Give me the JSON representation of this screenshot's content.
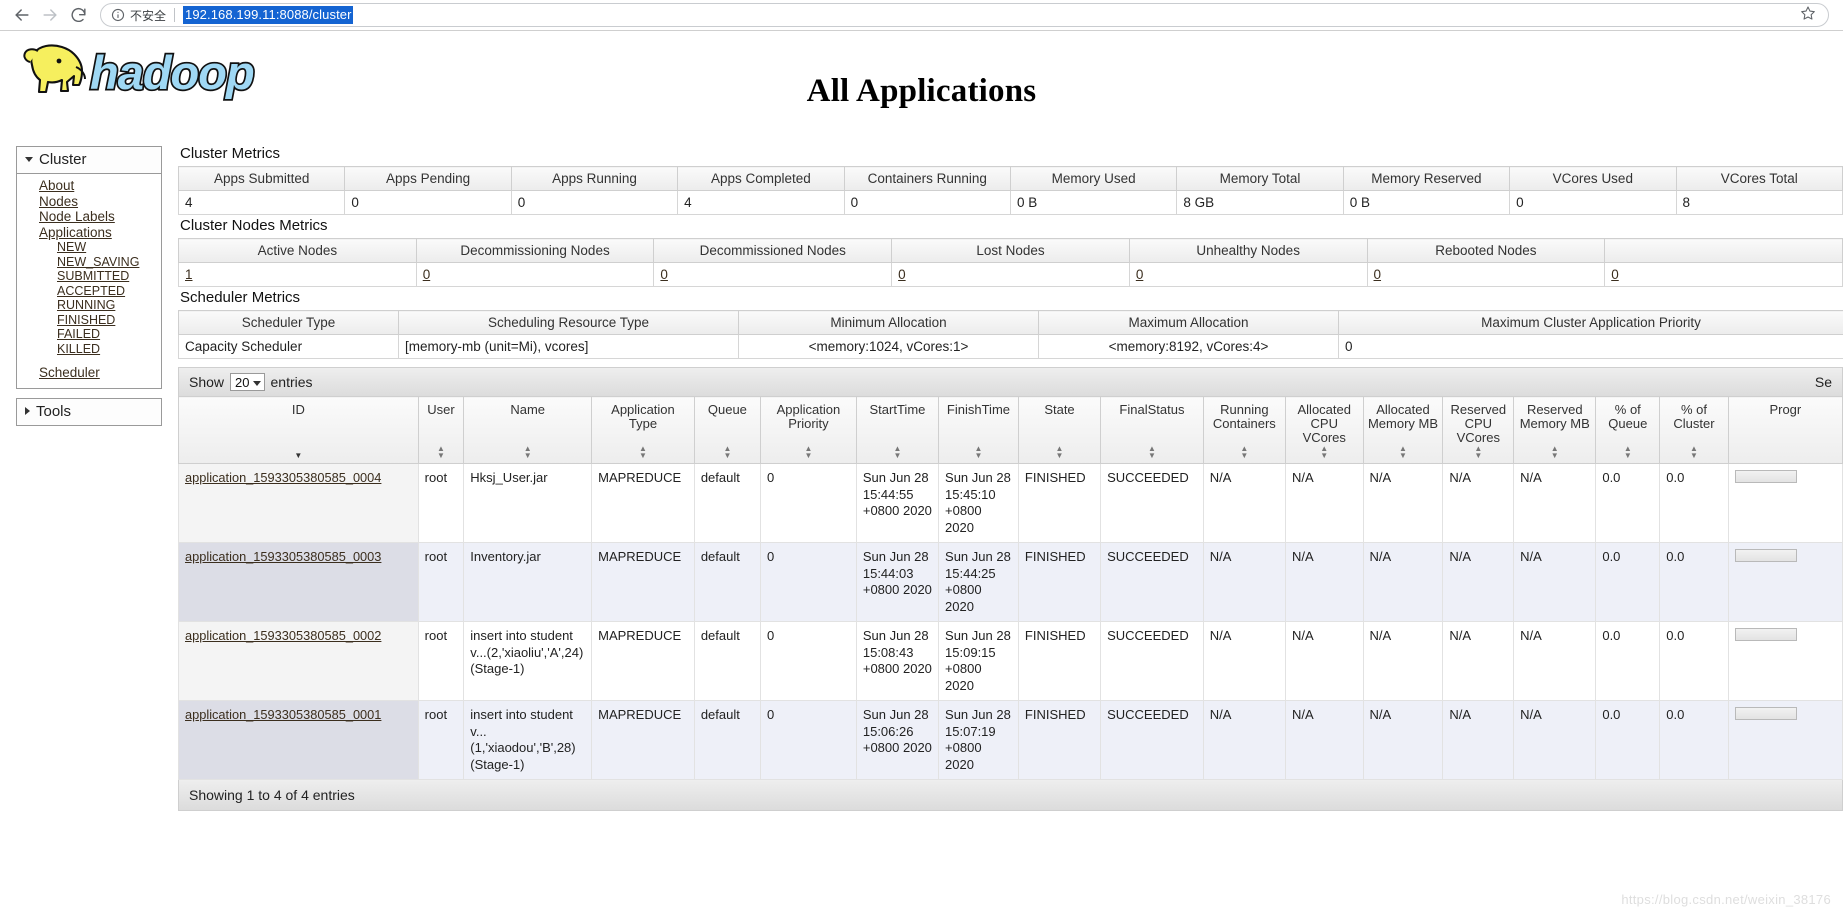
{
  "browser": {
    "back_icon": "back-arrow-icon",
    "forward_icon": "forward-arrow-icon",
    "reload_icon": "reload-icon",
    "info_icon": "info-circle-icon",
    "security_label": "不安全",
    "url": "192.168.199.11:8088/cluster",
    "star_icon": "bookmark-star-icon"
  },
  "header": {
    "logo_text": "hadoop",
    "title": "All Applications"
  },
  "sidebar": {
    "cluster": {
      "label": "Cluster",
      "items": [
        {
          "label": "About"
        },
        {
          "label": "Nodes"
        },
        {
          "label": "Node Labels"
        },
        {
          "label": "Applications"
        }
      ],
      "app_states": [
        {
          "label": "NEW"
        },
        {
          "label": "NEW_SAVING"
        },
        {
          "label": "SUBMITTED"
        },
        {
          "label": "ACCEPTED"
        },
        {
          "label": "RUNNING"
        },
        {
          "label": "FINISHED"
        },
        {
          "label": "FAILED"
        },
        {
          "label": "KILLED"
        }
      ],
      "scheduler": {
        "label": "Scheduler"
      }
    },
    "tools": {
      "label": "Tools"
    }
  },
  "cluster_metrics": {
    "title": "Cluster Metrics",
    "headers": [
      "Apps Submitted",
      "Apps Pending",
      "Apps Running",
      "Apps Completed",
      "Containers Running",
      "Memory Used",
      "Memory Total",
      "Memory Reserved",
      "VCores Used",
      "VCores Total"
    ],
    "values": [
      "4",
      "0",
      "0",
      "4",
      "0",
      "0 B",
      "8 GB",
      "0 B",
      "0",
      "8"
    ]
  },
  "cluster_nodes_metrics": {
    "title": "Cluster Nodes Metrics",
    "headers": [
      "Active Nodes",
      "Decommissioning Nodes",
      "Decommissioned Nodes",
      "Lost Nodes",
      "Unhealthy Nodes",
      "Rebooted Nodes",
      ""
    ],
    "values": [
      "1",
      "0",
      "0",
      "0",
      "0",
      "0",
      "0"
    ]
  },
  "scheduler_metrics": {
    "title": "Scheduler Metrics",
    "headers": [
      "Scheduler Type",
      "Scheduling Resource Type",
      "Minimum Allocation",
      "Maximum Allocation",
      "Maximum Cluster Application Priority"
    ],
    "values": [
      "Capacity Scheduler",
      "[memory-mb (unit=Mi), vcores]",
      "<memory:1024, vCores:1>",
      "<memory:8192, vCores:4>",
      "0"
    ]
  },
  "datatable": {
    "show_label": "Show",
    "page_length": "20",
    "entries_label": "entries",
    "search_label": "Se",
    "info": "Showing 1 to 4 of 4 entries",
    "columns": [
      "ID",
      "User",
      "Name",
      "Application Type",
      "Queue",
      "Application Priority",
      "StartTime",
      "FinishTime",
      "State",
      "FinalStatus",
      "Running Containers",
      "Allocated CPU VCores",
      "Allocated Memory MB",
      "Reserved CPU VCores",
      "Reserved Memory MB",
      "% of Queue",
      "% of Cluster",
      "Progr"
    ],
    "rows": [
      {
        "id": "application_1593305380585_0004",
        "user": "root",
        "name": "Hksj_User.jar",
        "app_type": "MAPREDUCE",
        "queue": "default",
        "priority": "0",
        "start_time": "Sun Jun 28 15:44:55 +0800 2020",
        "finish_time": "Sun Jun 28 15:45:10 +0800 2020",
        "state": "FINISHED",
        "final_status": "SUCCEEDED",
        "running_containers": "N/A",
        "alloc_cpu": "N/A",
        "alloc_mem": "N/A",
        "res_cpu": "N/A",
        "res_mem": "N/A",
        "pct_queue": "0.0",
        "pct_cluster": "0.0"
      },
      {
        "id": "application_1593305380585_0003",
        "user": "root",
        "name": "Inventory.jar",
        "app_type": "MAPREDUCE",
        "queue": "default",
        "priority": "0",
        "start_time": "Sun Jun 28 15:44:03 +0800 2020",
        "finish_time": "Sun Jun 28 15:44:25 +0800 2020",
        "state": "FINISHED",
        "final_status": "SUCCEEDED",
        "running_containers": "N/A",
        "alloc_cpu": "N/A",
        "alloc_mem": "N/A",
        "res_cpu": "N/A",
        "res_mem": "N/A",
        "pct_queue": "0.0",
        "pct_cluster": "0.0"
      },
      {
        "id": "application_1593305380585_0002",
        "user": "root",
        "name": "insert into student v...(2,'xiaoliu','A',24)(Stage-1)",
        "app_type": "MAPREDUCE",
        "queue": "default",
        "priority": "0",
        "start_time": "Sun Jun 28 15:08:43 +0800 2020",
        "finish_time": "Sun Jun 28 15:09:15 +0800 2020",
        "state": "FINISHED",
        "final_status": "SUCCEEDED",
        "running_containers": "N/A",
        "alloc_cpu": "N/A",
        "alloc_mem": "N/A",
        "res_cpu": "N/A",
        "res_mem": "N/A",
        "pct_queue": "0.0",
        "pct_cluster": "0.0"
      },
      {
        "id": "application_1593305380585_0001",
        "user": "root",
        "name": "insert into student v...(1,'xiaodou','B',28)(Stage-1)",
        "app_type": "MAPREDUCE",
        "queue": "default",
        "priority": "0",
        "start_time": "Sun Jun 28 15:06:26 +0800 2020",
        "finish_time": "Sun Jun 28 15:07:19 +0800 2020",
        "state": "FINISHED",
        "final_status": "SUCCEEDED",
        "running_containers": "N/A",
        "alloc_cpu": "N/A",
        "alloc_mem": "N/A",
        "res_cpu": "N/A",
        "res_mem": "N/A",
        "pct_queue": "0.0",
        "pct_cluster": "0.0"
      }
    ]
  },
  "watermark": "https://blog.csdn.net/weixin_38176"
}
